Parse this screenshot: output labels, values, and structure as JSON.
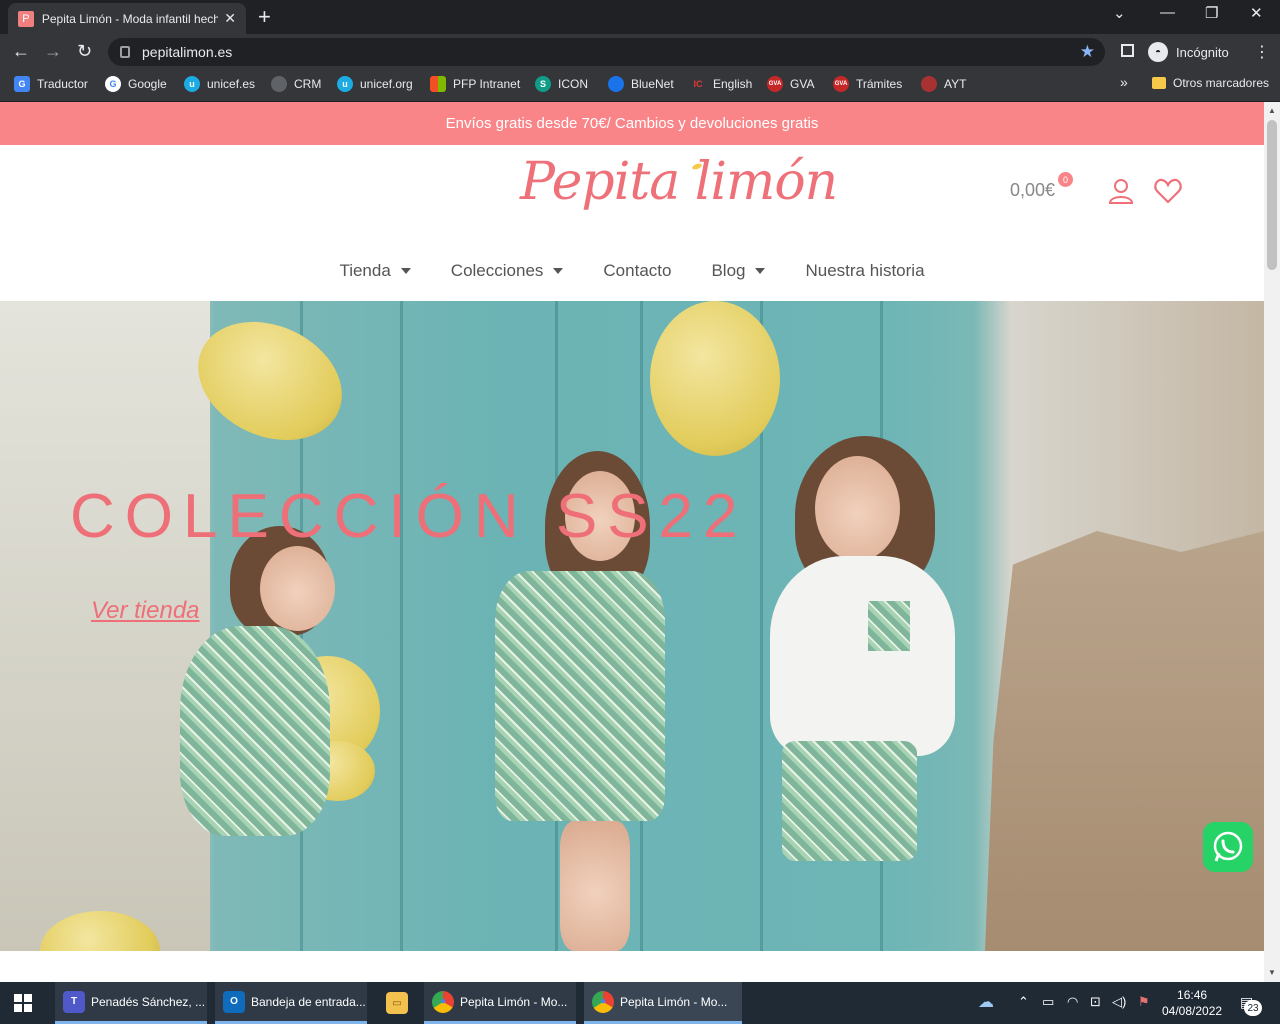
{
  "browser": {
    "tab_title": "Pepita Limón - Moda infantil hech",
    "tab_favicon": "P",
    "url": "pepitalimon.es",
    "incognito_label": "Incógnito",
    "bookmarks": [
      {
        "label": "Traductor",
        "icon": "G",
        "color": "#4285f4"
      },
      {
        "label": "Google",
        "icon": "G",
        "color": "#ffffff"
      },
      {
        "label": "unicef.es",
        "icon": "u",
        "color": "#1cabe2"
      },
      {
        "label": "CRM",
        "icon": "",
        "color": "#5f6368"
      },
      {
        "label": "unicef.org",
        "icon": "u",
        "color": "#1cabe2"
      },
      {
        "label": "PFP Intranet",
        "icon": "",
        "color": "#f25022"
      },
      {
        "label": "ICON",
        "icon": "S",
        "color": "#0f9d8a"
      },
      {
        "label": "BlueNet",
        "icon": "",
        "color": "#1a73e8"
      },
      {
        "label": "English",
        "icon": "IC",
        "color": "#e53935"
      },
      {
        "label": "GVA",
        "icon": "GVA",
        "color": "#c62828"
      },
      {
        "label": "Trámites",
        "icon": "GVA",
        "color": "#c62828"
      },
      {
        "label": "AYT",
        "icon": "",
        "color": "#a83232"
      }
    ],
    "bookmarks_overflow": "»",
    "other_bookmarks": "Otros marcadores"
  },
  "site": {
    "promo": "Envíos gratis desde 70€/ Cambios y devoluciones gratis",
    "logo": "Pepita limón",
    "cart_total": "0,00€",
    "cart_count": "0",
    "nav": [
      {
        "label": "Tienda",
        "dropdown": true
      },
      {
        "label": "Colecciones",
        "dropdown": true
      },
      {
        "label": "Contacto",
        "dropdown": false
      },
      {
        "label": "Blog",
        "dropdown": true
      },
      {
        "label": "Nuestra historia",
        "dropdown": false
      }
    ],
    "hero_title": "COLECCIÓN SS22",
    "hero_link": "Ver tienda",
    "accent": "#fa8589"
  },
  "taskbar": {
    "tasks": [
      {
        "label": "Penadés Sánchez, ...",
        "icon": "T",
        "color": "#5059c9"
      },
      {
        "label": "Bandeja de entrada...",
        "icon": "O",
        "color": "#0f6cbd"
      },
      {
        "label": "",
        "icon": "▭",
        "color": "#f2c14e"
      },
      {
        "label": "Pepita Limón - Mo...",
        "icon": "●",
        "color": "#34a853"
      },
      {
        "label": "Pepita Limón - Mo...",
        "icon": "●",
        "color": "#34a853"
      }
    ],
    "time": "16:46",
    "date": "04/08/2022",
    "notifications": "23"
  }
}
